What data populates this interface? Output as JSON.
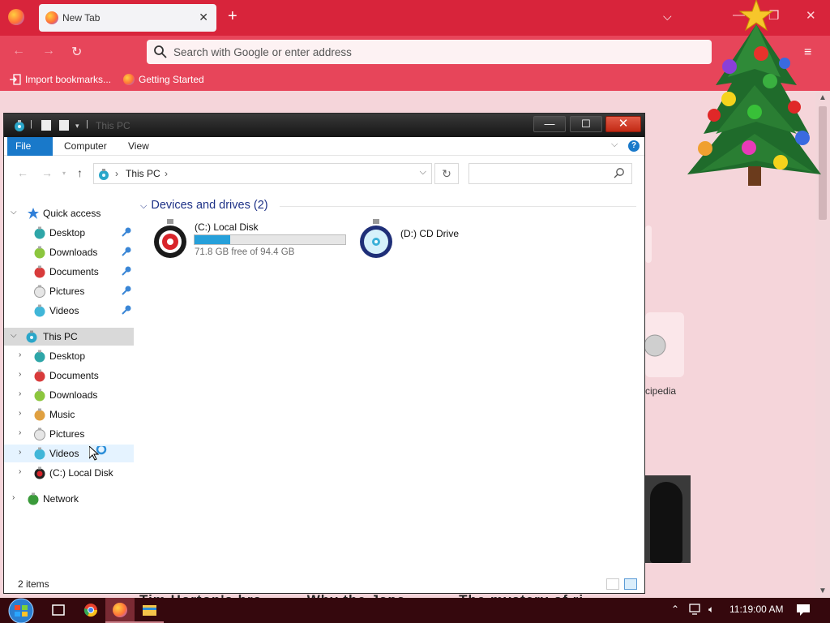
{
  "browser": {
    "tab_title": "New Tab",
    "url_placeholder": "Search with Google or enter address",
    "bookmarks": [
      "Import bookmarks...",
      "Getting Started"
    ]
  },
  "page": {
    "tile_label": "cipedia",
    "headline_fragments": [
      "Tim Horton's bra",
      "Why the Japa",
      "The mystery of ri"
    ]
  },
  "explorer": {
    "title": "This PC",
    "ribbon_tabs": [
      "File",
      "Computer",
      "View"
    ],
    "help": "?",
    "address": [
      "This PC"
    ],
    "nav": {
      "quick_access": "Quick access",
      "quick_items": [
        "Desktop",
        "Downloads",
        "Documents",
        "Pictures",
        "Videos"
      ],
      "this_pc": "This PC",
      "pc_items": [
        "Desktop",
        "Documents",
        "Downloads",
        "Music",
        "Pictures",
        "Videos",
        "(C:) Local Disk"
      ],
      "network": "Network"
    },
    "group_header": "Devices and drives (2)",
    "drives": [
      {
        "name": "(C:) Local Disk",
        "free": "71.8 GB free of 94.4 GB",
        "used_fraction": 0.239
      },
      {
        "name": "(D:) CD Drive"
      }
    ],
    "status": "2 items"
  },
  "taskbar": {
    "time": "11:19:00 AM"
  },
  "colors": {
    "firefox_tabbar": "#d8243b",
    "firefox_toolbar": "#e7455a",
    "ribbon_file": "#1979ca",
    "drive_bar_fill": "#26a0da",
    "group_header": "#1e3287",
    "taskbar": "#35080d"
  }
}
